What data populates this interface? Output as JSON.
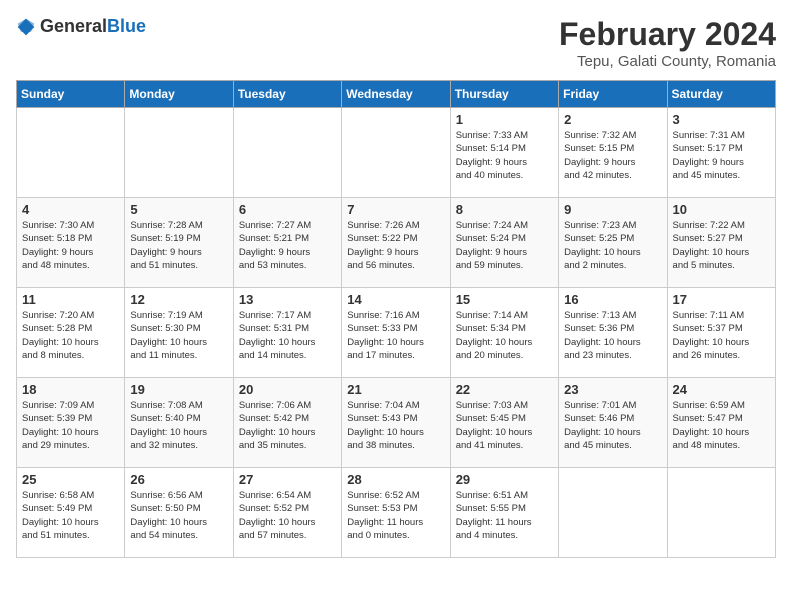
{
  "header": {
    "logo_general": "General",
    "logo_blue": "Blue",
    "title": "February 2024",
    "subtitle": "Tepu, Galati County, Romania"
  },
  "days_of_week": [
    "Sunday",
    "Monday",
    "Tuesday",
    "Wednesday",
    "Thursday",
    "Friday",
    "Saturday"
  ],
  "weeks": [
    [
      {
        "day": "",
        "info": ""
      },
      {
        "day": "",
        "info": ""
      },
      {
        "day": "",
        "info": ""
      },
      {
        "day": "",
        "info": ""
      },
      {
        "day": "1",
        "info": "Sunrise: 7:33 AM\nSunset: 5:14 PM\nDaylight: 9 hours\nand 40 minutes."
      },
      {
        "day": "2",
        "info": "Sunrise: 7:32 AM\nSunset: 5:15 PM\nDaylight: 9 hours\nand 42 minutes."
      },
      {
        "day": "3",
        "info": "Sunrise: 7:31 AM\nSunset: 5:17 PM\nDaylight: 9 hours\nand 45 minutes."
      }
    ],
    [
      {
        "day": "4",
        "info": "Sunrise: 7:30 AM\nSunset: 5:18 PM\nDaylight: 9 hours\nand 48 minutes."
      },
      {
        "day": "5",
        "info": "Sunrise: 7:28 AM\nSunset: 5:19 PM\nDaylight: 9 hours\nand 51 minutes."
      },
      {
        "day": "6",
        "info": "Sunrise: 7:27 AM\nSunset: 5:21 PM\nDaylight: 9 hours\nand 53 minutes."
      },
      {
        "day": "7",
        "info": "Sunrise: 7:26 AM\nSunset: 5:22 PM\nDaylight: 9 hours\nand 56 minutes."
      },
      {
        "day": "8",
        "info": "Sunrise: 7:24 AM\nSunset: 5:24 PM\nDaylight: 9 hours\nand 59 minutes."
      },
      {
        "day": "9",
        "info": "Sunrise: 7:23 AM\nSunset: 5:25 PM\nDaylight: 10 hours\nand 2 minutes."
      },
      {
        "day": "10",
        "info": "Sunrise: 7:22 AM\nSunset: 5:27 PM\nDaylight: 10 hours\nand 5 minutes."
      }
    ],
    [
      {
        "day": "11",
        "info": "Sunrise: 7:20 AM\nSunset: 5:28 PM\nDaylight: 10 hours\nand 8 minutes."
      },
      {
        "day": "12",
        "info": "Sunrise: 7:19 AM\nSunset: 5:30 PM\nDaylight: 10 hours\nand 11 minutes."
      },
      {
        "day": "13",
        "info": "Sunrise: 7:17 AM\nSunset: 5:31 PM\nDaylight: 10 hours\nand 14 minutes."
      },
      {
        "day": "14",
        "info": "Sunrise: 7:16 AM\nSunset: 5:33 PM\nDaylight: 10 hours\nand 17 minutes."
      },
      {
        "day": "15",
        "info": "Sunrise: 7:14 AM\nSunset: 5:34 PM\nDaylight: 10 hours\nand 20 minutes."
      },
      {
        "day": "16",
        "info": "Sunrise: 7:13 AM\nSunset: 5:36 PM\nDaylight: 10 hours\nand 23 minutes."
      },
      {
        "day": "17",
        "info": "Sunrise: 7:11 AM\nSunset: 5:37 PM\nDaylight: 10 hours\nand 26 minutes."
      }
    ],
    [
      {
        "day": "18",
        "info": "Sunrise: 7:09 AM\nSunset: 5:39 PM\nDaylight: 10 hours\nand 29 minutes."
      },
      {
        "day": "19",
        "info": "Sunrise: 7:08 AM\nSunset: 5:40 PM\nDaylight: 10 hours\nand 32 minutes."
      },
      {
        "day": "20",
        "info": "Sunrise: 7:06 AM\nSunset: 5:42 PM\nDaylight: 10 hours\nand 35 minutes."
      },
      {
        "day": "21",
        "info": "Sunrise: 7:04 AM\nSunset: 5:43 PM\nDaylight: 10 hours\nand 38 minutes."
      },
      {
        "day": "22",
        "info": "Sunrise: 7:03 AM\nSunset: 5:45 PM\nDaylight: 10 hours\nand 41 minutes."
      },
      {
        "day": "23",
        "info": "Sunrise: 7:01 AM\nSunset: 5:46 PM\nDaylight: 10 hours\nand 45 minutes."
      },
      {
        "day": "24",
        "info": "Sunrise: 6:59 AM\nSunset: 5:47 PM\nDaylight: 10 hours\nand 48 minutes."
      }
    ],
    [
      {
        "day": "25",
        "info": "Sunrise: 6:58 AM\nSunset: 5:49 PM\nDaylight: 10 hours\nand 51 minutes."
      },
      {
        "day": "26",
        "info": "Sunrise: 6:56 AM\nSunset: 5:50 PM\nDaylight: 10 hours\nand 54 minutes."
      },
      {
        "day": "27",
        "info": "Sunrise: 6:54 AM\nSunset: 5:52 PM\nDaylight: 10 hours\nand 57 minutes."
      },
      {
        "day": "28",
        "info": "Sunrise: 6:52 AM\nSunset: 5:53 PM\nDaylight: 11 hours\nand 0 minutes."
      },
      {
        "day": "29",
        "info": "Sunrise: 6:51 AM\nSunset: 5:55 PM\nDaylight: 11 hours\nand 4 minutes."
      },
      {
        "day": "",
        "info": ""
      },
      {
        "day": "",
        "info": ""
      }
    ]
  ]
}
